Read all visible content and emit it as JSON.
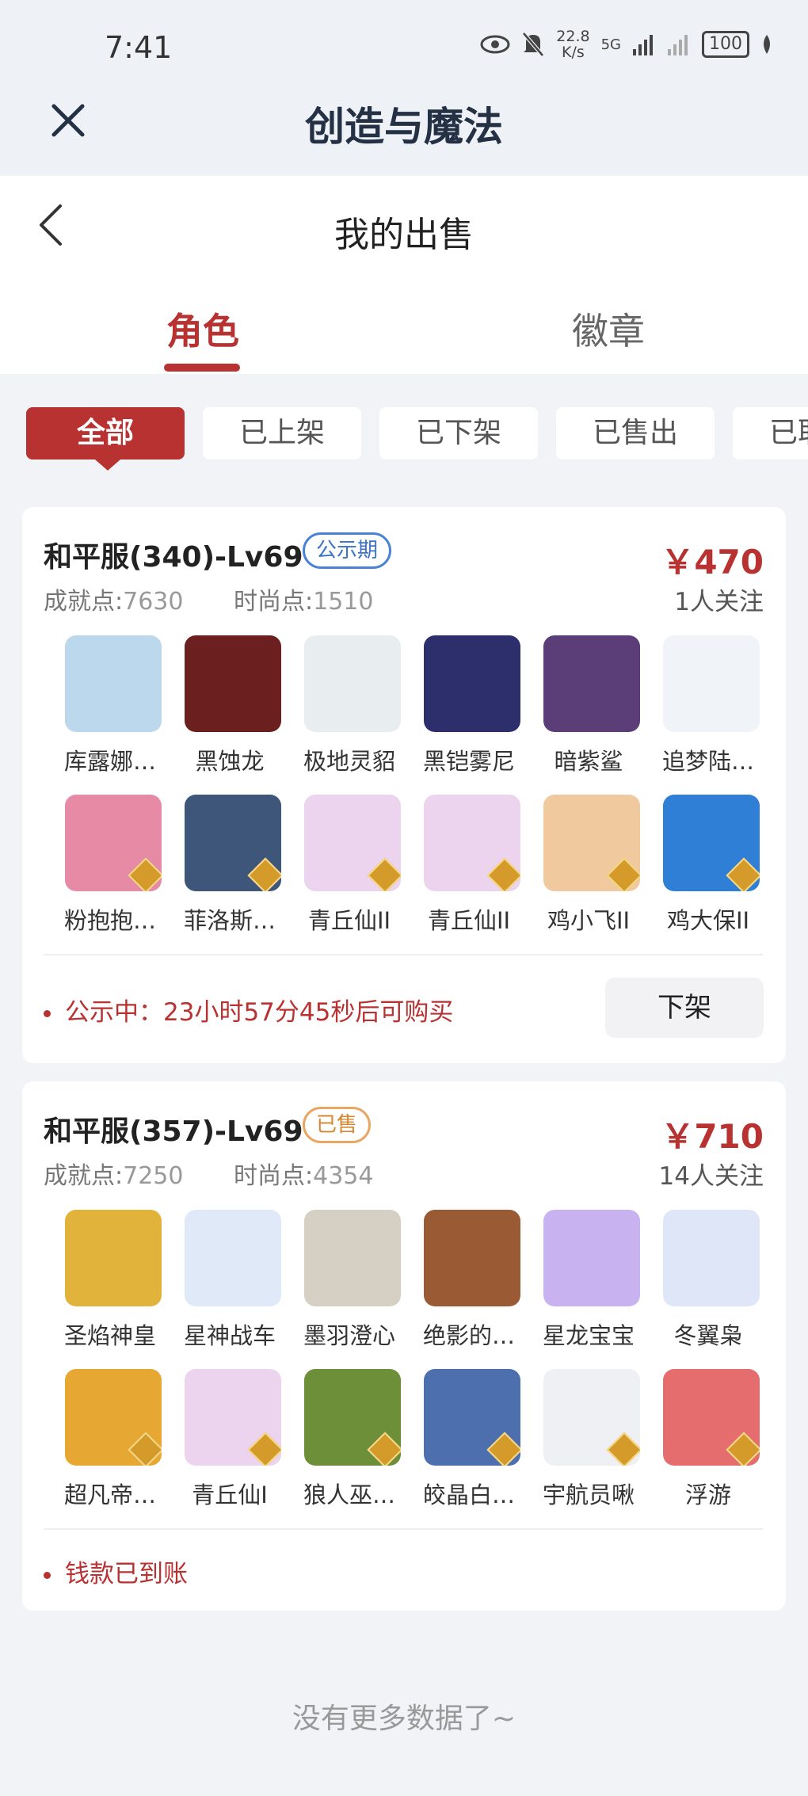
{
  "status_bar": {
    "time": "7:41",
    "net_speed": "22.8",
    "net_unit": "K/s",
    "network": "5G",
    "battery": "100"
  },
  "app": {
    "title": "创造与魔法"
  },
  "page": {
    "title": "我的出售"
  },
  "tabs": [
    {
      "label": "角色",
      "active": true
    },
    {
      "label": "徽章",
      "active": false
    }
  ],
  "filters": [
    {
      "label": "全部",
      "active": true
    },
    {
      "label": "已上架",
      "active": false
    },
    {
      "label": "已下架",
      "active": false
    },
    {
      "label": "已售出",
      "active": false
    },
    {
      "label": "已取消",
      "active": false
    }
  ],
  "listings": [
    {
      "title": "和平服(340)-Lv69",
      "status": "公示期",
      "price": "￥470",
      "achievement_label": "成就点:",
      "achievement": "7630",
      "fashion_label": "时尚点:",
      "fashion": "1510",
      "followers": "1人关注",
      "items": [
        {
          "name": "库露娜…",
          "color": "#bcd8ec"
        },
        {
          "name": "黑蚀龙",
          "color": "#6b1f1f"
        },
        {
          "name": "极地灵貂",
          "color": "#e8eef0"
        },
        {
          "name": "黑铠雾尼",
          "color": "#2c2f6b"
        },
        {
          "name": "暗紫鲨",
          "color": "#5b3d78"
        },
        {
          "name": "追梦陆…",
          "color": "#f0f4f8"
        },
        {
          "name": "粉抱抱…",
          "color": "#e78aa6"
        },
        {
          "name": "菲洛斯…",
          "color": "#3d5679"
        },
        {
          "name": "青丘仙II",
          "color": "#ecd3ee"
        },
        {
          "name": "青丘仙II",
          "color": "#ecd3ee"
        },
        {
          "name": "鸡小飞II",
          "color": "#f1c99e"
        },
        {
          "name": "鸡大保II",
          "color": "#2f7fd6"
        }
      ],
      "notice_prefix": "公示中：",
      "notice": "23小时57分45秒后可购买",
      "action": "下架"
    },
    {
      "title": "和平服(357)-Lv69",
      "status": "已售",
      "price": "￥710",
      "achievement_label": "成就点:",
      "achievement": "7250",
      "fashion_label": "时尚点:",
      "fashion": "4354",
      "followers": "14人关注",
      "items": [
        {
          "name": "圣焰神皇",
          "color": "#e2b33a"
        },
        {
          "name": "星神战车",
          "color": "#dfe9f7"
        },
        {
          "name": "墨羽澄心",
          "color": "#d6cfc4"
        },
        {
          "name": "绝影的…",
          "color": "#9a5a34"
        },
        {
          "name": "星龙宝宝",
          "color": "#c9b2f0"
        },
        {
          "name": "冬翼枭",
          "color": "#dfe6f7"
        },
        {
          "name": "超凡帝…",
          "color": "#e6a833"
        },
        {
          "name": "青丘仙I",
          "color": "#ecd3ee"
        },
        {
          "name": "狼人巫…",
          "color": "#6d8f3a"
        },
        {
          "name": "皎晶白…",
          "color": "#4e6fae"
        },
        {
          "name": "宇航员啾",
          "color": "#eef0f4"
        },
        {
          "name": "浮游",
          "color": "#e56d6d"
        }
      ],
      "notice_prefix": "",
      "notice": "钱款已到账",
      "action": ""
    }
  ],
  "footer": {
    "no_more": "没有更多数据了~"
  }
}
